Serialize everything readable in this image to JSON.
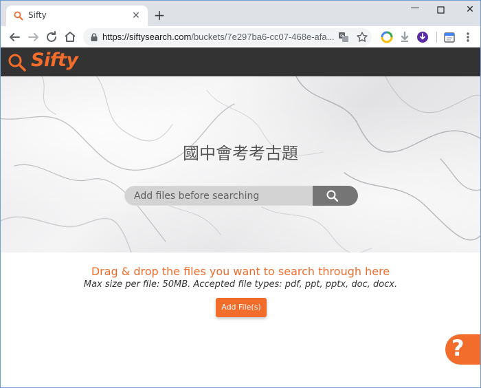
{
  "browser": {
    "tab": {
      "title": "Sifty",
      "close_glyph": "✕",
      "favicon": "search-icon"
    },
    "new_tab_glyph": "+",
    "window_controls": {
      "minimize": "—",
      "close": "✕"
    },
    "address": {
      "host": "https://siftysearch.com",
      "path": "/buckets/7e297ba6-cc07-468e-afa..."
    },
    "toolbar_icons": [
      "back-arrow-icon",
      "forward-arrow-icon",
      "reload-icon",
      "home-icon",
      "lock-icon",
      "translate-icon",
      "bookmark-star-icon",
      "extension-icon",
      "download-icon",
      "profile-icon",
      "calendar-icon",
      "menu-icon"
    ]
  },
  "site": {
    "logo_text": "Sifty",
    "brand_color": "#f26c2c"
  },
  "hero": {
    "title": "國中會考考古題",
    "search_placeholder": "Add files before searching"
  },
  "upload": {
    "title": "Drag & drop the files you want to search through here",
    "subtitle": "Max size per file: 50MB. Accepted file types: pdf, ppt, pptx, doc, docx.",
    "button_label": "Add File(s)"
  },
  "help": {
    "label": "?"
  }
}
